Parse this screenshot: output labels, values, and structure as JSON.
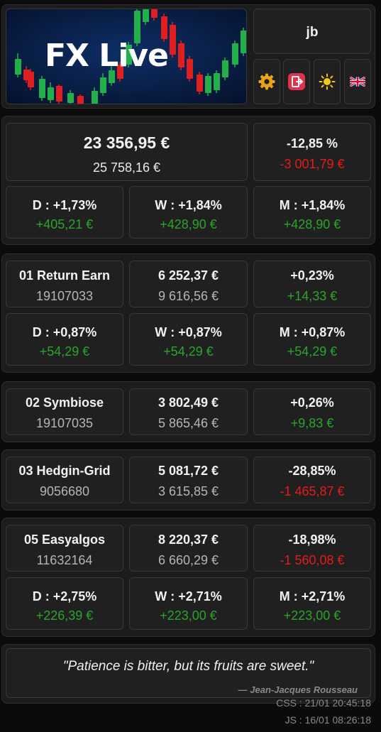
{
  "header": {
    "logo_text": "FX Live",
    "user": "jb",
    "icons": [
      "gear-icon",
      "logout-icon",
      "sun-icon",
      "uk-flag-icon"
    ]
  },
  "summary": {
    "balance": "23 356,95 €",
    "deposit": "25 758,16 €",
    "percent": "-12,85 %",
    "amount": "-3 001,79 €",
    "periods": [
      {
        "label": "D : +1,73%",
        "value": "+405,21 €"
      },
      {
        "label": "W : +1,84%",
        "value": "+428,90 €"
      },
      {
        "label": "M : +1,84%",
        "value": "+428,90 €"
      }
    ]
  },
  "accounts": [
    {
      "name": "01 Return Earn",
      "id": "19107033",
      "balance": "6 252,37 €",
      "deposit": "9 616,56 €",
      "percent": "+0,23%",
      "amount": "+14,33 €",
      "periods": [
        {
          "label": "D : +0,87%",
          "value": "+54,29 €"
        },
        {
          "label": "W : +0,87%",
          "value": "+54,29 €"
        },
        {
          "label": "M : +0,87%",
          "value": "+54,29 €"
        }
      ]
    },
    {
      "name": "02 Symbiose",
      "id": "19107035",
      "balance": "3 802,49 €",
      "deposit": "5 865,46 €",
      "percent": "+0,26%",
      "amount": "+9,83 €"
    },
    {
      "name": "03 Hedgin-Grid",
      "id": "9056680",
      "balance": "5 081,72 €",
      "deposit": "3 615,85 €",
      "percent": "-28,85%",
      "amount": "-1 465,87 €"
    },
    {
      "name": "05 Easyalgos",
      "id": "11632164",
      "balance": "8 220,37 €",
      "deposit": "6 660,29 €",
      "percent": "-18,98%",
      "amount": "-1 560,08 €",
      "periods": [
        {
          "label": "D : +2,75%",
          "value": "+226,39 €"
        },
        {
          "label": "W : +2,71%",
          "value": "+223,00 €"
        },
        {
          "label": "M : +2,71%",
          "value": "+223,00 €"
        }
      ]
    }
  ],
  "quote": {
    "text": "\"Patience is bitter, but its fruits are sweet.\"",
    "author": "— Jean-Jacques Rousseau"
  },
  "footer": {
    "css": "CSS : 21/01 20:45:18",
    "js": "JS : 16/01 08:26:18"
  },
  "colors": {
    "positive": "#2aa52a",
    "negative": "#e41b1b",
    "background": "#0b0b0b",
    "card": "#202020"
  }
}
